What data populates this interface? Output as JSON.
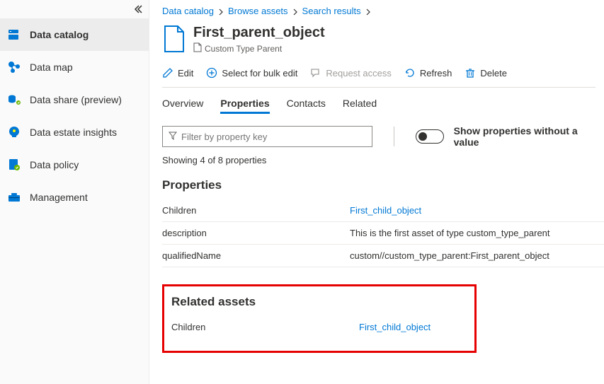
{
  "sidebar": {
    "items": [
      {
        "label": "Data catalog"
      },
      {
        "label": "Data map"
      },
      {
        "label": "Data share (preview)"
      },
      {
        "label": "Data estate insights"
      },
      {
        "label": "Data policy"
      },
      {
        "label": "Management"
      }
    ]
  },
  "breadcrumb": {
    "items": [
      "Data catalog",
      "Browse assets",
      "Search results"
    ]
  },
  "asset": {
    "title": "First_parent_object",
    "subtype": "Custom Type Parent"
  },
  "toolbar": {
    "edit": "Edit",
    "bulk": "Select for bulk edit",
    "request": "Request access",
    "refresh": "Refresh",
    "delete": "Delete"
  },
  "tabs": {
    "overview": "Overview",
    "properties": "Properties",
    "contacts": "Contacts",
    "related": "Related"
  },
  "filter": {
    "placeholder": "Filter by property key",
    "toggle_label": "Show properties without a value",
    "counter": "Showing 4 of 8 properties"
  },
  "properties": {
    "heading": "Properties",
    "rows": [
      {
        "key": "Children",
        "link": "First_child_object"
      },
      {
        "key": "description",
        "value": "This is the first asset of type custom_type_parent"
      },
      {
        "key": "qualifiedName",
        "value": "custom//custom_type_parent:First_parent_object"
      }
    ]
  },
  "related": {
    "heading": "Related assets",
    "row": {
      "key": "Children",
      "link": "First_child_object"
    }
  }
}
